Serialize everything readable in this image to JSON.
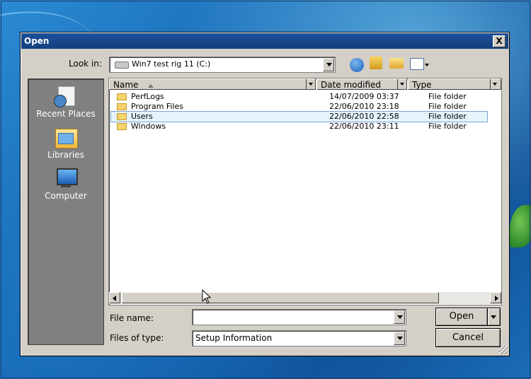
{
  "dialog": {
    "title": "Open",
    "close_glyph": "X",
    "look_in_label": "Look in:",
    "look_in_value": "Win7 test rig 11 (C:)",
    "file_name_label": "File name:",
    "file_name_value": "",
    "files_of_type_label": "Files of type:",
    "files_of_type_value": "Setup Information",
    "open_label": "Open",
    "cancel_label": "Cancel"
  },
  "places": [
    {
      "label": "Recent Places",
      "icon": "recent-places-icon"
    },
    {
      "label": "Libraries",
      "icon": "libraries-icon"
    },
    {
      "label": "Computer",
      "icon": "computer-icon"
    }
  ],
  "columns": {
    "name": "Name",
    "date": "Date modified",
    "type": "Type"
  },
  "files": [
    {
      "name": "PerfLogs",
      "date": "14/07/2009 03:37",
      "type": "File folder"
    },
    {
      "name": "Program Files",
      "date": "22/06/2010 23:18",
      "type": "File folder"
    },
    {
      "name": "Users",
      "date": "22/06/2010 22:58",
      "type": "File folder"
    },
    {
      "name": "Windows",
      "date": "22/06/2010 23:11",
      "type": "File folder"
    }
  ],
  "colors": {
    "titlebar": "#1d4e9a",
    "selection": "#e5f3fb",
    "dialog_bg": "#d4d0c8"
  }
}
